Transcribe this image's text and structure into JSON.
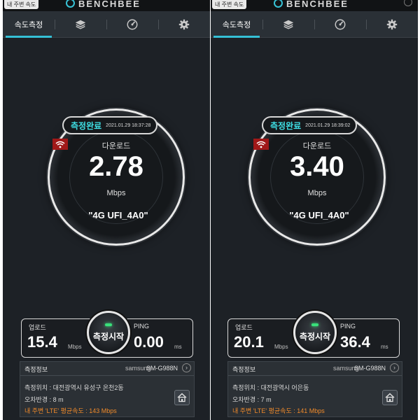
{
  "screens": [
    {
      "top": {
        "nearby_button": "내 주변 속도",
        "logo": "BENCHBEE"
      },
      "tabs": [
        {
          "label": "속도측정",
          "icon": "speed"
        },
        {
          "icon": "layers-icon"
        },
        {
          "icon": "dial-icon"
        },
        {
          "icon": "gear-icon"
        }
      ],
      "gauge": {
        "status": "측정완료",
        "timestamp": "2021.01.29 18:37:28",
        "download_label": "다운로드",
        "download_value": "2.78",
        "unit": "Mbps",
        "network": "\"4G UFI_4A0\""
      },
      "result": {
        "upload_label": "업로드",
        "upload_value": "15.4",
        "upload_unit": "Mbps",
        "start_label": "측정시작",
        "ping_label": "PING",
        "ping_value": "0.00",
        "ping_unit": "ms"
      },
      "info": {
        "title": "측정정보",
        "brand": "samsung",
        "model": "SM-G988N",
        "location": "측정위치 : 대전광역시 유성구 온천2동",
        "radius": "오차반경 : 8 m",
        "average": "내 주변 'LTE' 평균속도 :  143 Mbps"
      }
    },
    {
      "top": {
        "nearby_button": "내 주변 속도",
        "logo": "BENCHBEE"
      },
      "tabs": [
        {
          "label": "속도측정",
          "icon": "speed"
        },
        {
          "icon": "layers-icon"
        },
        {
          "icon": "dial-icon"
        },
        {
          "icon": "gear-icon"
        }
      ],
      "gauge": {
        "status": "측정완료",
        "timestamp": "2021.01.29 18:39:02",
        "download_label": "다운로드",
        "download_value": "3.40",
        "unit": "Mbps",
        "network": "\"4G UFI_4A0\""
      },
      "result": {
        "upload_label": "업로드",
        "upload_value": "20.1",
        "upload_unit": "Mbps",
        "start_label": "측정시작",
        "ping_label": "PING",
        "ping_value": "36.4",
        "ping_unit": "ms"
      },
      "info": {
        "title": "측정정보",
        "brand": "samsung",
        "model": "SM-G988N",
        "location": "측정위치 : 대전광역시 어은동",
        "radius": "오차반경 : 7 m",
        "average": "내 주변 'LTE' 평균속도 :  141 Mbps"
      }
    }
  ],
  "colors": {
    "accent": "#35c0d6",
    "status_text": "#3fe0e6",
    "average_text": "#f08a2a",
    "wifi_badge": "#a01818"
  }
}
